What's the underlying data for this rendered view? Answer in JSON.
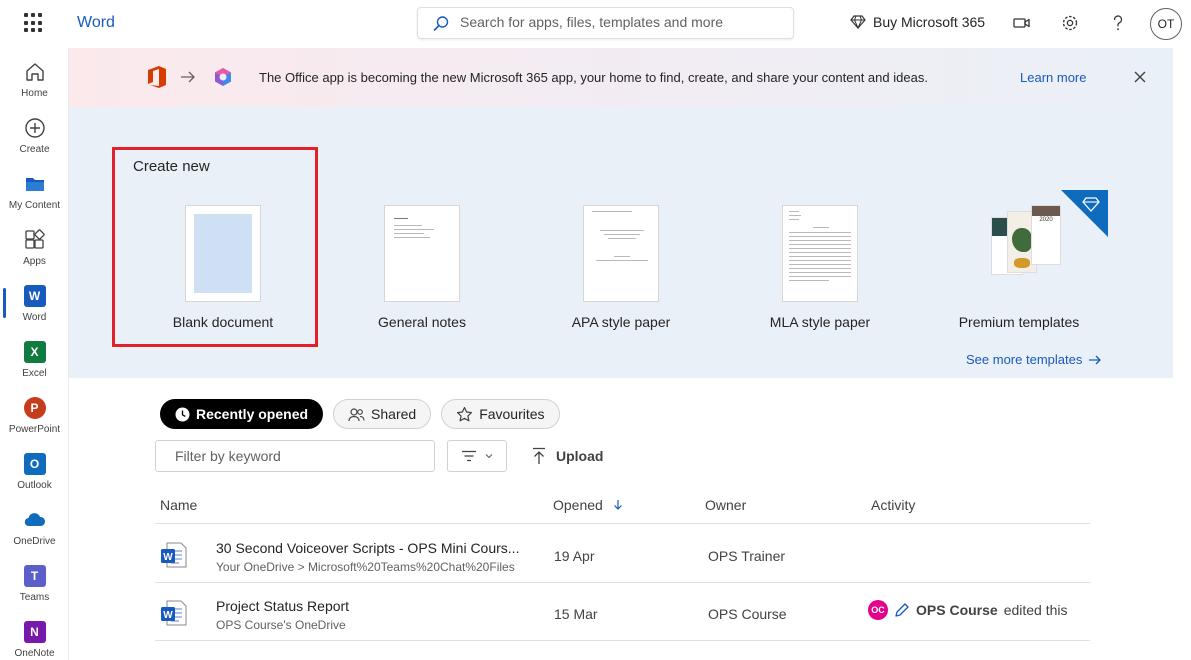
{
  "header": {
    "app_title": "Word",
    "search_placeholder": "Search for apps, files, templates and more",
    "buy_label": "Buy Microsoft 365",
    "avatar_initials": "OT",
    "icons": [
      "app-launcher-icon",
      "search-icon",
      "diamond-icon",
      "video-icon",
      "gear-icon",
      "help-icon"
    ]
  },
  "rail": {
    "items": [
      {
        "label": "Home",
        "icon": "home-icon"
      },
      {
        "label": "Create",
        "icon": "plus-circle-icon"
      },
      {
        "label": "My Content",
        "icon": "folder-icon"
      },
      {
        "label": "Apps",
        "icon": "apps-icon"
      },
      {
        "label": "Word",
        "icon": "word-icon",
        "tile": "W",
        "color": "#185abd"
      },
      {
        "label": "Excel",
        "icon": "excel-icon",
        "tile": "X",
        "color": "#107c41"
      },
      {
        "label": "PowerPoint",
        "icon": "powerpoint-icon",
        "tile": "P",
        "color": "#c43e1c"
      },
      {
        "label": "Outlook",
        "icon": "outlook-icon",
        "tile": "O",
        "color": "#0f6cbd"
      },
      {
        "label": "OneDrive",
        "icon": "onedrive-icon"
      },
      {
        "label": "Teams",
        "icon": "teams-icon",
        "tile": "T",
        "color": "#5b5fc7"
      },
      {
        "label": "OneNote",
        "icon": "onenote-icon",
        "tile": "N",
        "color": "#7719aa"
      }
    ]
  },
  "banner": {
    "message": "The Office app is becoming the new Microsoft 365 app, your home to find, create, and share your content and ideas.",
    "link": "Learn more"
  },
  "create": {
    "title": "Create new",
    "templates": [
      {
        "name": "Blank document"
      },
      {
        "name": "General notes"
      },
      {
        "name": "APA style paper"
      },
      {
        "name": "MLA style paper"
      },
      {
        "name": "Premium templates"
      }
    ],
    "see_more": "See more templates",
    "premium_year": "2020"
  },
  "files": {
    "tabs": [
      "Recently opened",
      "Shared",
      "Favourites"
    ],
    "filter_placeholder": "Filter by keyword",
    "upload_label": "Upload",
    "columns": [
      "Name",
      "Opened",
      "Owner",
      "Activity"
    ],
    "rows": [
      {
        "name": "30 Second Voiceover Scripts - OPS Mini Cours...",
        "path": "Your OneDrive > Microsoft%20Teams%20Chat%20Files",
        "opened": "19 Apr",
        "owner": "OPS Trainer",
        "activity": ""
      },
      {
        "name": "Project Status Report",
        "path": "OPS Course's OneDrive",
        "opened": "15 Mar",
        "owner": "OPS Course",
        "activity_initials": "OC",
        "activity_user": "OPS Course",
        "activity": "edited this"
      }
    ]
  },
  "colors": {
    "accent": "#185abd",
    "highlight": "#e3202a",
    "create_bg": "#eaf0f7"
  }
}
